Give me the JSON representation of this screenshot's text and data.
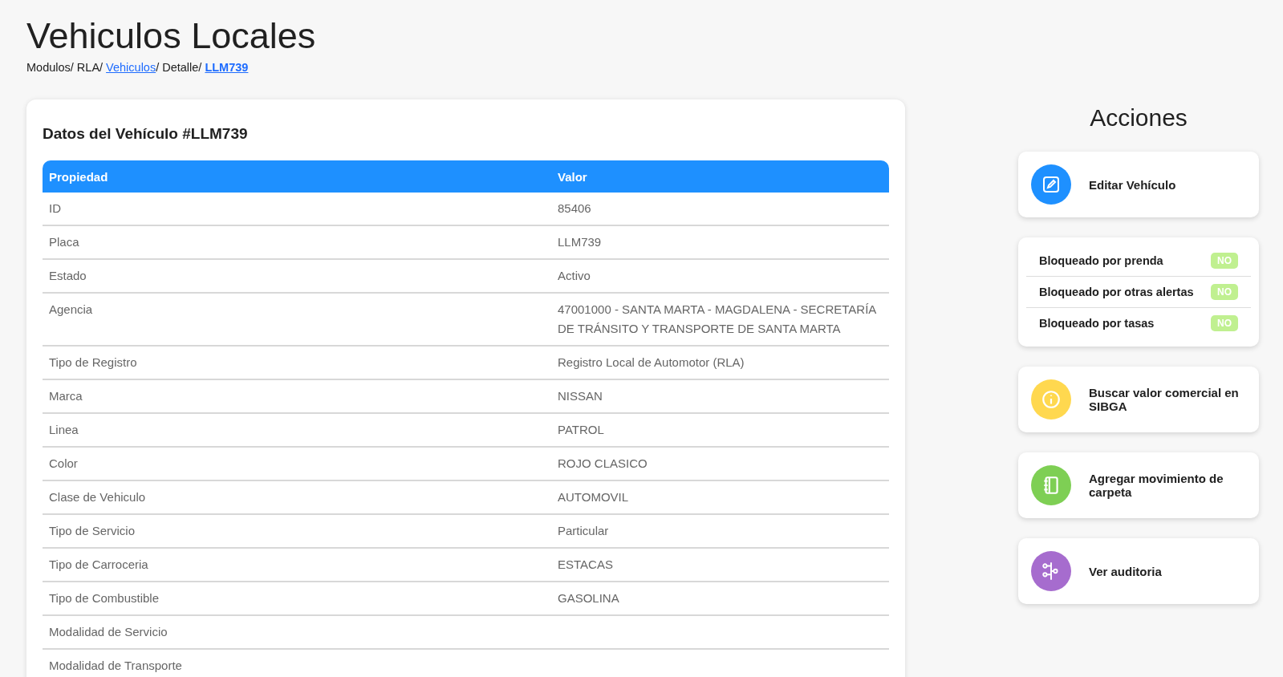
{
  "page": {
    "title": "Vehiculos Locales"
  },
  "breadcrumb": [
    {
      "label": "Modulos/",
      "kind": "text"
    },
    {
      "label": "RLA/",
      "kind": "text"
    },
    {
      "label": "Vehiculos",
      "kind": "link"
    },
    {
      "label": "/ Detalle/",
      "kind": "text"
    },
    {
      "label": "LLM739",
      "kind": "current"
    }
  ],
  "vehicle_card": {
    "title": "Datos del Vehículo #LLM739",
    "columns": [
      "Propiedad",
      "Valor"
    ],
    "rows": [
      {
        "property": "ID",
        "value": "85406"
      },
      {
        "property": "Placa",
        "value": "LLM739"
      },
      {
        "property": "Estado",
        "value": "Activo"
      },
      {
        "property": "Agencia",
        "value": "47001000 - SANTA MARTA - MAGDALENA - SECRETARÍA DE TRÁNSITO Y TRANSPORTE DE SANTA MARTA"
      },
      {
        "property": "Tipo de Registro",
        "value": "Registro Local de Automotor (RLA)"
      },
      {
        "property": "Marca",
        "value": "NISSAN"
      },
      {
        "property": "Linea",
        "value": "PATROL"
      },
      {
        "property": "Color",
        "value": "ROJO CLASICO"
      },
      {
        "property": "Clase de Vehiculo",
        "value": "AUTOMOVIL"
      },
      {
        "property": "Tipo de Servicio",
        "value": "Particular"
      },
      {
        "property": "Tipo de Carroceria",
        "value": "ESTACAS"
      },
      {
        "property": "Tipo de Combustible",
        "value": "GASOLINA"
      },
      {
        "property": "Modalidad de Servicio"
      },
      {
        "property": "Modalidad de Transporte"
      }
    ]
  },
  "actions": {
    "title": "Acciones",
    "cards": [
      {
        "kind": "edit",
        "color": "#1e90ff",
        "label": "Editar Vehículo"
      },
      {
        "kind": "locks",
        "items": [
          {
            "label": "Bloqueado por prenda",
            "badge": "NO",
            "blocked": false
          },
          {
            "label": "Bloqueado por otras alertas",
            "badge": "NO",
            "blocked": false
          },
          {
            "label": "Bloqueado por tasas",
            "badge": "NO",
            "blocked": false
          }
        ]
      },
      {
        "kind": "info",
        "color": "#ffd84f",
        "label": "Buscar valor comercial en SIBGA"
      },
      {
        "kind": "notebook",
        "color": "#7ecf54",
        "label": "Agregar movimiento de carpeta"
      },
      {
        "kind": "audit",
        "color": "#a66cce",
        "label": "Ver auditoria"
      }
    ]
  }
}
